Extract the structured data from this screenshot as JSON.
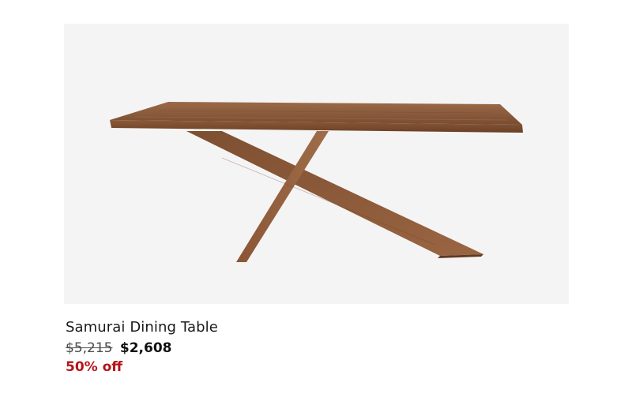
{
  "product": {
    "name": "Samurai Dining Table",
    "original_price": "$5,215",
    "sale_price": "$2,608",
    "discount": "50% off",
    "image_background": "#f5f4f4",
    "wood_color": "#8a5a3b"
  },
  "colors": {
    "discount_red": "#b3141b",
    "text": "#1a1a1a"
  }
}
